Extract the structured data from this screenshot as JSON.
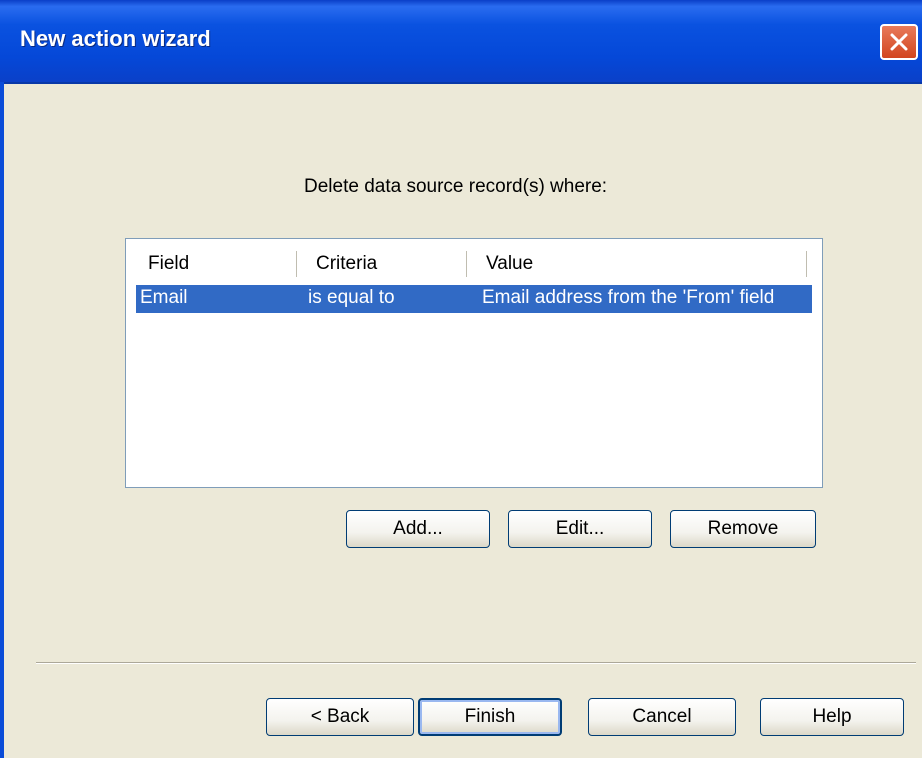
{
  "window": {
    "title": "New action wizard"
  },
  "prompt": "Delete data source record(s) where:",
  "list": {
    "columns": [
      "Field",
      "Criteria",
      "Value"
    ],
    "rows": [
      {
        "field": "Email",
        "criteria": "is equal to",
        "value": "Email address from the 'From' field",
        "selected": true
      }
    ]
  },
  "row_buttons": {
    "add": "Add...",
    "edit": "Edit...",
    "remove": "Remove"
  },
  "nav_buttons": {
    "back": "< Back",
    "finish": "Finish",
    "cancel": "Cancel",
    "help": "Help"
  },
  "colors": {
    "titlebar": "#0a52e0",
    "selection": "#316ac5",
    "dialog_bg": "#ece9d8",
    "close_button": "#d2451e"
  },
  "icons": {
    "close": "close-icon"
  }
}
